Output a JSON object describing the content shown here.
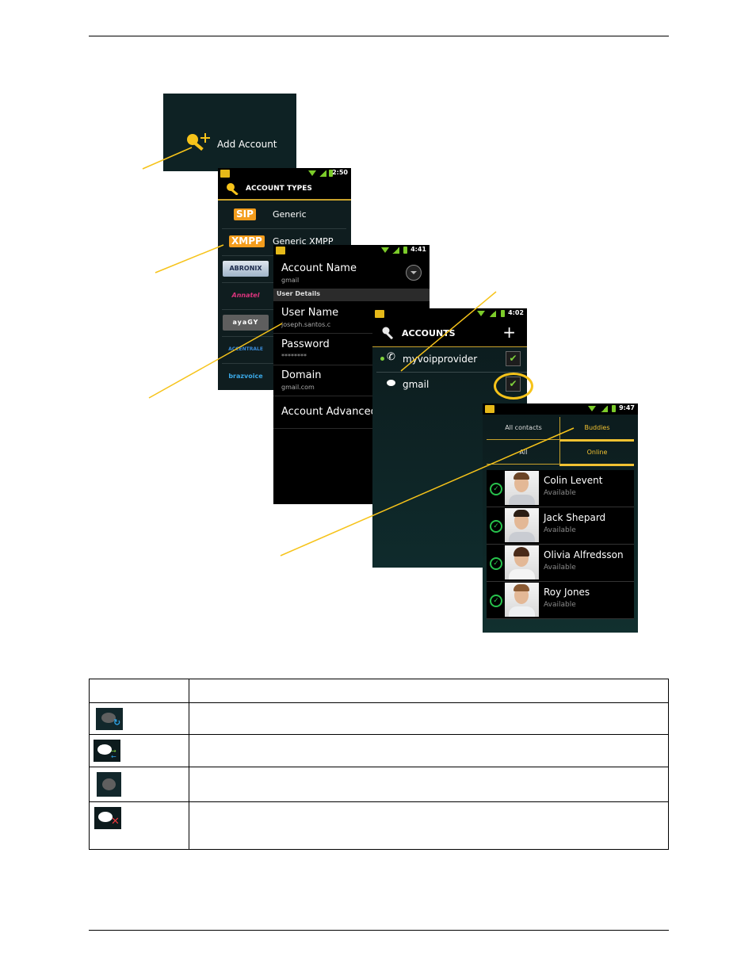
{
  "panels": {
    "add_account": {
      "label": "Add Account",
      "icon": "key-plus-icon"
    },
    "account_types": {
      "status_time": "2:50",
      "title": "ACCOUNT TYPES",
      "items": [
        {
          "badge": "SIP",
          "label": "Generic"
        },
        {
          "badge": "XMPP",
          "label": "Generic XMPP"
        }
      ],
      "providers": [
        "ABRONIX",
        "Annatel",
        "ayaGY",
        "ACCENTRALE",
        "brazvoice"
      ]
    },
    "account_detail": {
      "status_time": "4:41",
      "account_name_label": "Account Name",
      "account_name_value": "gmail",
      "section_header": "User Details",
      "username_label": "User Name",
      "username_value": "joseph.santos.c",
      "password_label": "Password",
      "password_value": "********",
      "domain_label": "Domain",
      "domain_value": "gmail.com",
      "advanced_label": "Account Advanced"
    },
    "accounts": {
      "status_time": "4:02",
      "title": "ACCOUNTS",
      "add_symbol": "+",
      "items": [
        {
          "name": "myvoipprovider",
          "type": "sip",
          "checked": true,
          "check_glyph": "✔"
        },
        {
          "name": "gmail",
          "type": "xmpp",
          "checked": true,
          "check_glyph": "✔"
        }
      ]
    },
    "contacts": {
      "status_time": "9:47",
      "tabs": [
        "All contacts",
        "Buddies"
      ],
      "subtabs": [
        "All",
        "Online"
      ],
      "active_tab": "Buddies",
      "active_subtab": "Online",
      "list": [
        {
          "name": "Colin Levent",
          "status": "Available"
        },
        {
          "name": "Jack Shepard",
          "status": "Available"
        },
        {
          "name": "Olivia Alfredsson",
          "status": "Available"
        },
        {
          "name": "Roy Jones",
          "status": "Available"
        }
      ]
    }
  },
  "colors": {
    "callout": "#f6c31a",
    "accent_gold": "#c9a22c",
    "status_green": "#27c24c",
    "badge_orange": "#f39d1d"
  },
  "table": {
    "header": [
      "",
      ""
    ],
    "rows": [
      {
        "icon": "chat-syncing-icon",
        "description": ""
      },
      {
        "icon": "chat-connected-icon",
        "description": ""
      },
      {
        "icon": "chat-disabled-icon",
        "description": ""
      },
      {
        "icon": "chat-error-icon",
        "description": ""
      }
    ]
  }
}
